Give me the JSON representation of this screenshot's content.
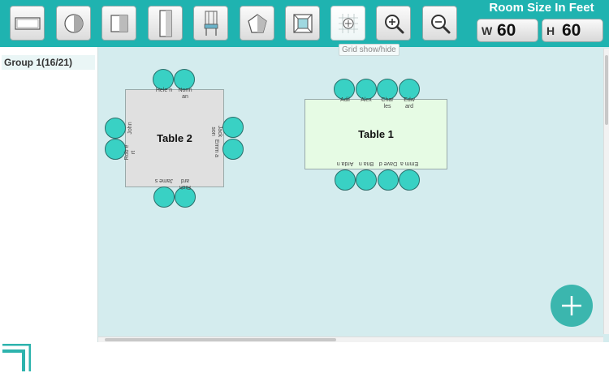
{
  "toolbar": {
    "tools": [
      {
        "name": "rectangle-table-tool",
        "icon": "rectangle-table-icon"
      },
      {
        "name": "round-table-tool",
        "icon": "round-table-icon"
      },
      {
        "name": "square-table-tool",
        "icon": "square-table-icon"
      },
      {
        "name": "long-table-tool",
        "icon": "long-table-icon"
      },
      {
        "name": "chair-tool",
        "icon": "chair-icon"
      },
      {
        "name": "pentagon-table-tool",
        "icon": "pentagon-icon"
      },
      {
        "name": "fit-to-screen-tool",
        "icon": "fit-screen-icon"
      },
      {
        "name": "grid-toggle-tool",
        "icon": "grid-icon"
      },
      {
        "name": "zoom-in-tool",
        "icon": "zoom-in-icon"
      },
      {
        "name": "zoom-out-tool",
        "icon": "zoom-out-icon"
      }
    ],
    "tooltip": "Grid show/hide",
    "room_title": "Room Size In Feet",
    "width_label": "W",
    "width_value": "60",
    "height_label": "H",
    "height_value": "60"
  },
  "sidebar": {
    "groups": [
      {
        "label": "Group 1(16/21)"
      }
    ]
  },
  "canvas": {
    "tables": [
      {
        "label": "Table 2",
        "seats": [
          {
            "side": "top",
            "name": "Hele n"
          },
          {
            "side": "top",
            "name": "Norm an"
          },
          {
            "side": "right",
            "name": "Jack son"
          },
          {
            "side": "right",
            "name": "Emm a"
          },
          {
            "side": "bottom",
            "name": "Rich ard"
          },
          {
            "side": "bottom",
            "name": "Jame s"
          },
          {
            "side": "left",
            "name": "Rob e rt"
          },
          {
            "side": "left",
            "name": "John"
          }
        ]
      },
      {
        "label": "Table 1",
        "seats": [
          {
            "side": "top",
            "name": "Adil"
          },
          {
            "side": "top",
            "name": "Alex"
          },
          {
            "side": "top",
            "name": "Char les"
          },
          {
            "side": "top",
            "name": "Edw ard"
          },
          {
            "side": "bottom",
            "name": "Arda n"
          },
          {
            "side": "bottom",
            "name": "Bria n"
          },
          {
            "side": "bottom",
            "name": "Dave d"
          },
          {
            "side": "bottom",
            "name": "Emm a"
          }
        ]
      }
    ]
  },
  "colors": {
    "toolbar": "#1fb3b0",
    "canvas": "#d4ecee",
    "seat": "#39d1c4",
    "table1": "#e6fbe4",
    "table2": "#e0e0e0",
    "fab": "#3bb6ae"
  }
}
